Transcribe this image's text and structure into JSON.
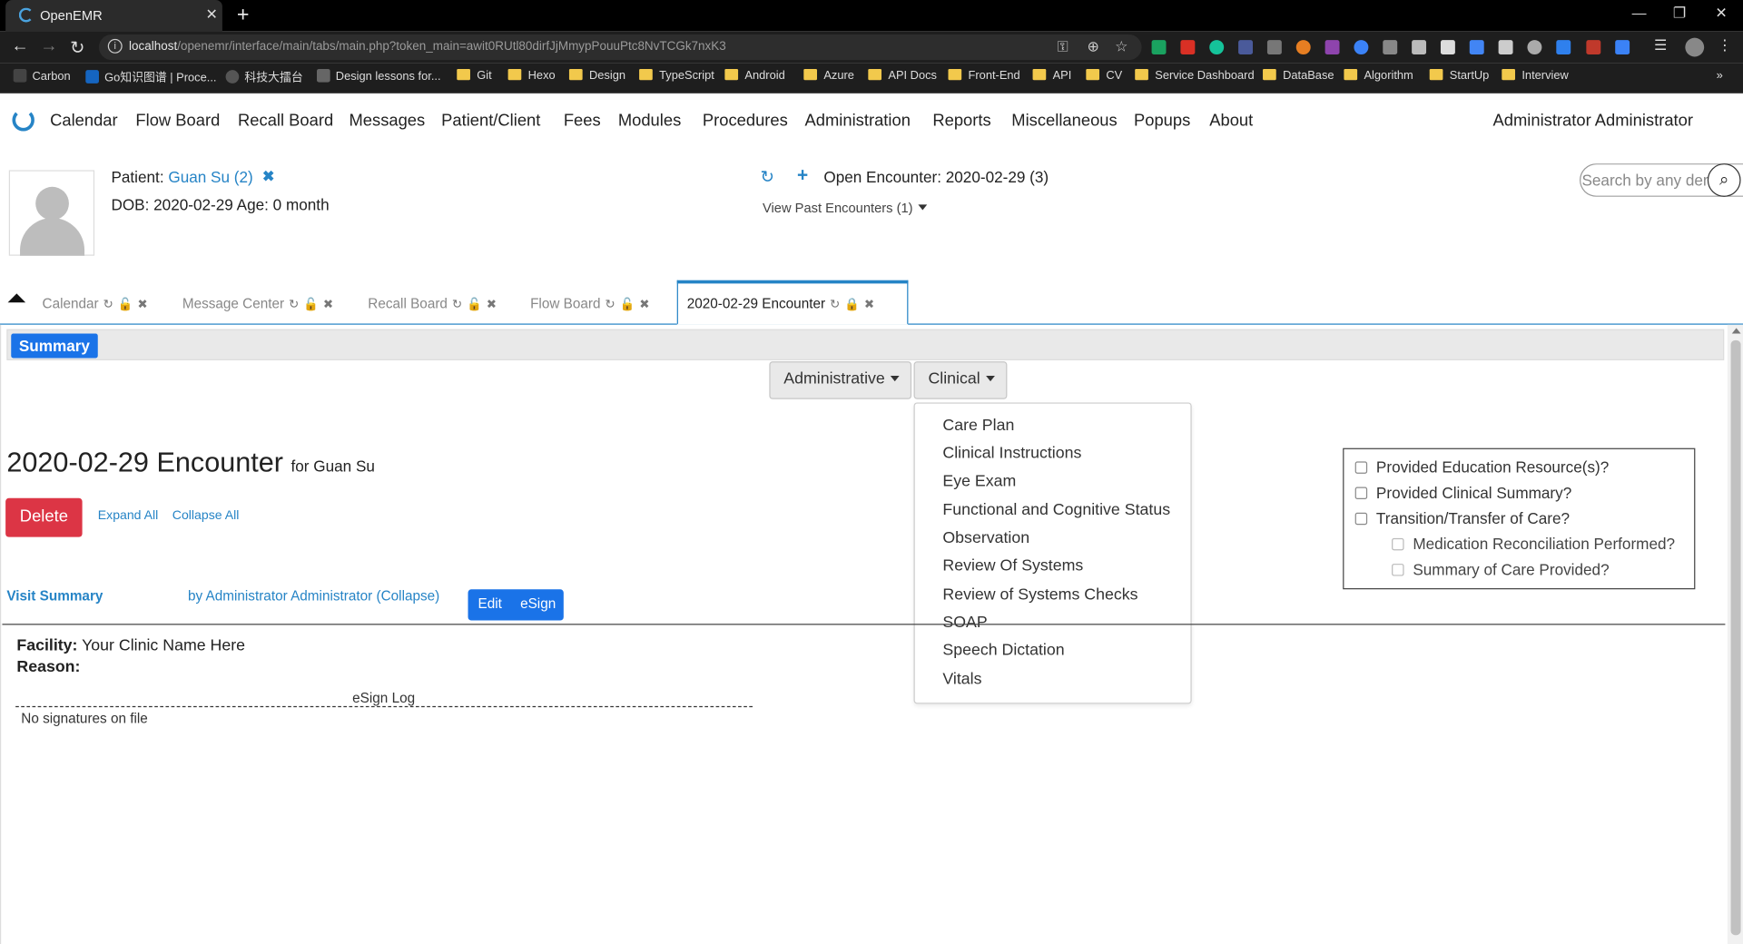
{
  "browser": {
    "tab_title": "OpenEMR",
    "url_host": "localhost",
    "url_path": "/openemr/interface/main/tabs/main.php?token_main=awit0RUtl80dirfJjMmypPouuPtc8NvTCGk7nxK3",
    "bookmarks": [
      "Carbon",
      "Go知识图谱 | Proce...",
      "科技大擂台",
      "Design lessons for...",
      "Git",
      "Hexo",
      "Design",
      "TypeScript",
      "Android",
      "Azure",
      "API Docs",
      "Front-End",
      "API",
      "CV",
      "Service Dashboard",
      "DataBase",
      "Algorithm",
      "StartUp",
      "Interview"
    ]
  },
  "menu": {
    "items": [
      "Calendar",
      "Flow Board",
      "Recall Board",
      "Messages",
      "Patient/Client",
      "Fees",
      "Modules",
      "Procedures",
      "Administration",
      "Reports",
      "Miscellaneous",
      "Popups",
      "About"
    ],
    "user": "Administrator Administrator"
  },
  "patient": {
    "label": "Patient:",
    "name": "Guan Su (2)",
    "dob_line": "DOB: 2020-02-29 Age: 0 month",
    "open_encounter": "Open Encounter: 2020-02-29 (3)",
    "past_encounters": "View Past Encounters  (1)",
    "search_placeholder": "Search by any demographics"
  },
  "tabs": [
    {
      "label": "Calendar"
    },
    {
      "label": "Message Center"
    },
    {
      "label": "Recall Board"
    },
    {
      "label": "Flow Board"
    },
    {
      "label": "2020-02-29 Encounter",
      "active": true
    }
  ],
  "encounter": {
    "summary_tab": "Summary",
    "administrative_btn": "Administrative",
    "clinical_btn": "Clinical",
    "clinical_menu": [
      "Care Plan",
      "Clinical Instructions",
      "Eye Exam",
      "Functional and Cognitive Status",
      "Observation",
      "Review Of Systems",
      "Review of Systems Checks",
      "SOAP",
      "Speech Dictation",
      "Vitals"
    ],
    "title": "2020-02-29 Encounter",
    "title_for": "for Guan Su",
    "delete_label": "Delete",
    "expand_all": "Expand All",
    "collapse_all": "Collapse All",
    "visit_summary": "Visit Summary",
    "by_line": "by Administrator Administrator (Collapse)",
    "edit_label": "Edit",
    "esign_label": "eSign",
    "facility_label": "Facility:",
    "facility_value": "Your Clinic Name Here",
    "reason_label": "Reason:",
    "esign_log": "eSign Log",
    "no_signatures": "No signatures on file",
    "checklist": [
      {
        "label": "Provided Education Resource(s)?",
        "checked": false
      },
      {
        "label": "Provided Clinical Summary?",
        "checked": false
      },
      {
        "label": "Transition/Transfer of Care?",
        "checked": false
      },
      {
        "label": "Medication Reconciliation Performed?",
        "checked": false,
        "disabled": true
      },
      {
        "label": "Summary of Care Provided?",
        "checked": false,
        "disabled": true
      }
    ]
  },
  "colors": {
    "accent": "#2684c6",
    "primary_button": "#1a73e8",
    "danger": "#dc3545"
  }
}
